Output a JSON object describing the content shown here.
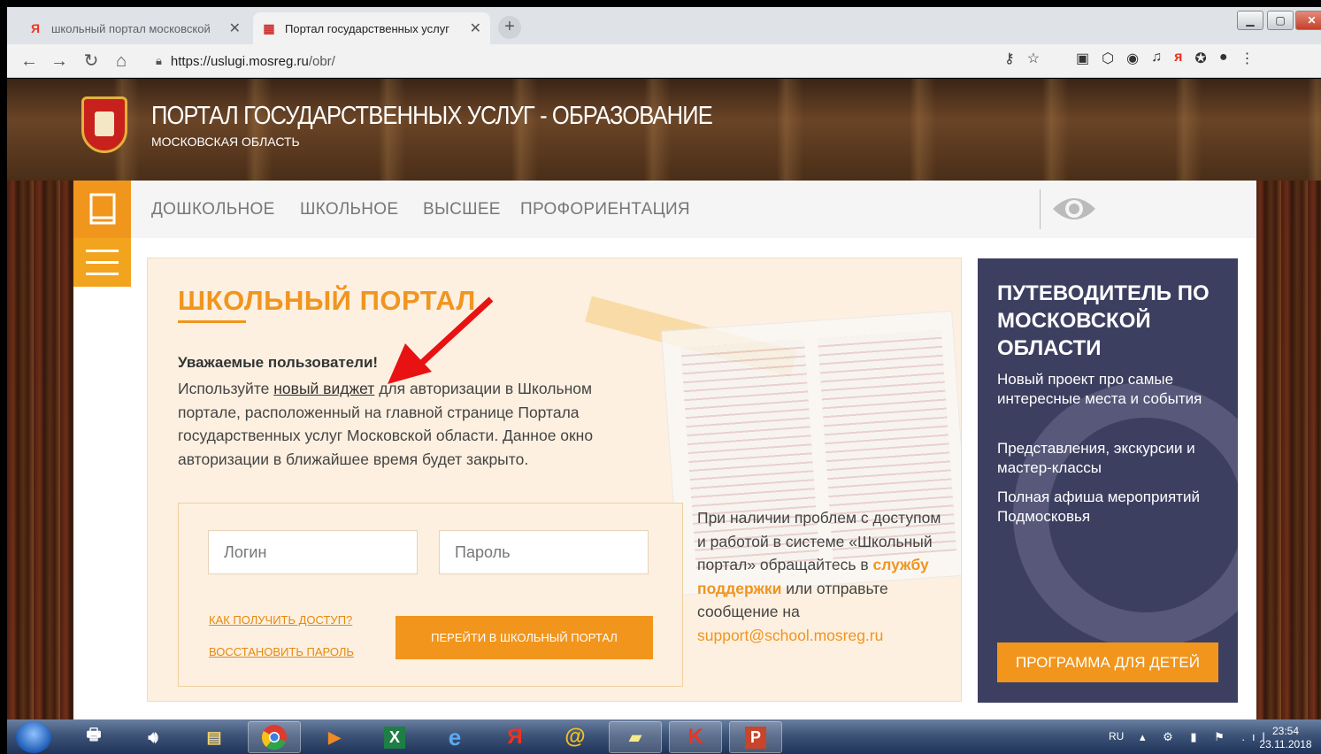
{
  "browser": {
    "tabs": [
      {
        "title": "школьный портал московской",
        "favicon": "Я",
        "active": false
      },
      {
        "title": "Портал государственных услуг",
        "favicon": "▦",
        "active": true
      }
    ],
    "url_host": "https://uslugi.mosreg.ru",
    "url_path": "/obr/"
  },
  "site": {
    "title": "ПОРТАЛ ГОСУДАРСТВЕННЫХ УСЛУГ - ОБРАЗОВАНИЕ",
    "subtitle": "МОСКОВСКАЯ ОБЛАСТЬ"
  },
  "nav": {
    "items": [
      "ДОШКОЛЬНОЕ",
      "ШКОЛЬНОЕ",
      "ВЫСШЕЕ",
      "ПРОФОРИЕНТАЦИЯ"
    ]
  },
  "portal": {
    "title": "ШКОЛЬНЫЙ ПОРТАЛ",
    "greeting": "Уважаемые пользователи!",
    "msg_before": "Используйте ",
    "msg_link": "новый виджет",
    "msg_after": " для авторизации в Школьном портале, расположенный на главной странице Портала государственных услуг Московской области. Данное окно авторизации в ближайшее время будет закрыто.",
    "login_placeholder": "Логин",
    "password_placeholder": "Пароль",
    "access_link": "КАК ПОЛУЧИТЬ ДОСТУП?",
    "restore_link": "ВОССТАНОВИТЬ ПАРОЛЬ",
    "go_button": "ПЕРЕЙТИ В ШКОЛЬНЫЙ ПОРТАЛ",
    "help_text": "При наличии проблем с доступом и работой в системе «Школьный портал» обращайтесь в ",
    "help_link": "службу поддержки",
    "help_text2": " или отправьте сообщение на ",
    "help_email": "support@school.mosreg.ru"
  },
  "guide": {
    "title": "ПУТЕВОДИТЕЛЬ ПО МОСКОВСКОЙ ОБЛАСТИ",
    "p1": "Новый проект про самые интересные места и события",
    "p2": "Представления, экскурсии и мастер-классы",
    "p3": "Полная афиша мероприятий Подмосковья",
    "button": "ПРОГРАММА ДЛЯ ДЕТЕЙ"
  },
  "taskbar": {
    "lang": "RU",
    "time": "23:54",
    "date": "23.11.2018"
  },
  "colors": {
    "accent": "#f1951c",
    "guide_bg": "#3d3f60",
    "card_bg": "#fdf0e0"
  }
}
